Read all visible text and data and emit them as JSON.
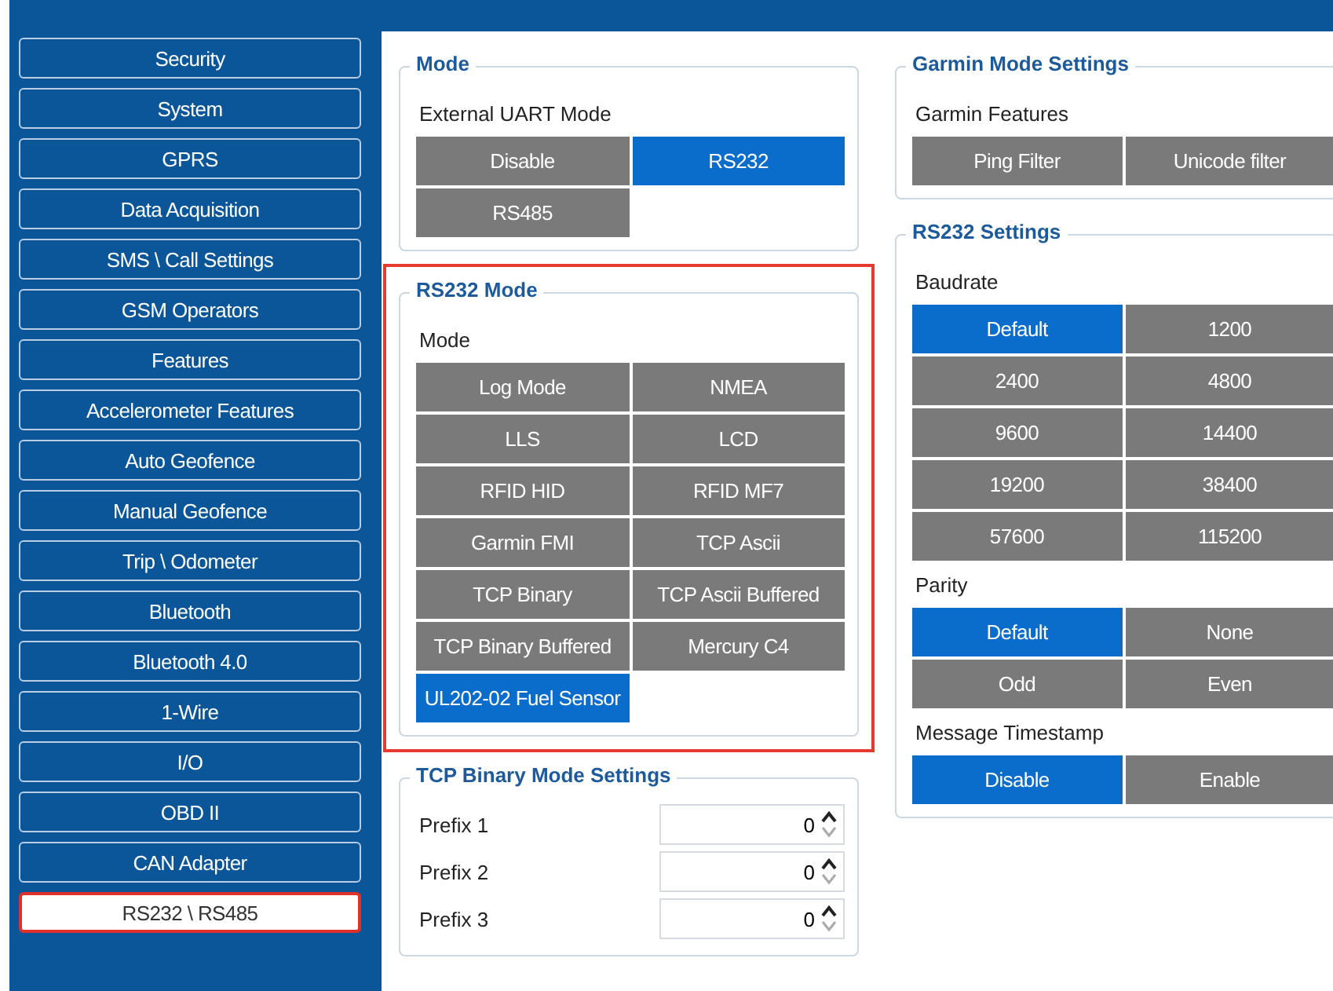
{
  "sidebar": {
    "items": [
      {
        "label": "Security",
        "selected": false
      },
      {
        "label": "System",
        "selected": false
      },
      {
        "label": "GPRS",
        "selected": false
      },
      {
        "label": "Data Acquisition",
        "selected": false
      },
      {
        "label": "SMS \\ Call Settings",
        "selected": false
      },
      {
        "label": "GSM Operators",
        "selected": false
      },
      {
        "label": "Features",
        "selected": false
      },
      {
        "label": "Accelerometer Features",
        "selected": false
      },
      {
        "label": "Auto Geofence",
        "selected": false
      },
      {
        "label": "Manual Geofence",
        "selected": false
      },
      {
        "label": "Trip \\ Odometer",
        "selected": false
      },
      {
        "label": "Bluetooth",
        "selected": false
      },
      {
        "label": "Bluetooth 4.0",
        "selected": false
      },
      {
        "label": "1-Wire",
        "selected": false
      },
      {
        "label": "I/O",
        "selected": false
      },
      {
        "label": "OBD II",
        "selected": false
      },
      {
        "label": "CAN Adapter",
        "selected": false
      },
      {
        "label": "RS232 \\ RS485",
        "selected": true
      }
    ]
  },
  "left_column": [
    {
      "title": "Mode",
      "kind": "options",
      "highlighted": false,
      "sections": [
        {
          "label": "External UART Mode",
          "options": [
            {
              "label": "Disable",
              "selected": false
            },
            {
              "label": "RS232",
              "selected": true
            },
            {
              "label": "RS485",
              "selected": false
            }
          ]
        }
      ]
    },
    {
      "title": "RS232 Mode",
      "kind": "options",
      "highlighted": true,
      "sections": [
        {
          "label": "Mode",
          "options": [
            {
              "label": "Log Mode",
              "selected": false
            },
            {
              "label": "NMEA",
              "selected": false
            },
            {
              "label": "LLS",
              "selected": false
            },
            {
              "label": "LCD",
              "selected": false
            },
            {
              "label": "RFID HID",
              "selected": false
            },
            {
              "label": "RFID MF7",
              "selected": false
            },
            {
              "label": "Garmin FMI",
              "selected": false
            },
            {
              "label": "TCP Ascii",
              "selected": false
            },
            {
              "label": "TCP Binary",
              "selected": false
            },
            {
              "label": "TCP Ascii Buffered",
              "selected": false
            },
            {
              "label": "TCP Binary Buffered",
              "selected": false
            },
            {
              "label": "Mercury C4",
              "selected": false
            },
            {
              "label": "UL202-02 Fuel Sensor",
              "selected": true
            }
          ]
        }
      ]
    },
    {
      "title": "TCP Binary Mode Settings",
      "kind": "fields",
      "highlighted": false,
      "fields": [
        {
          "label": "Prefix 1",
          "value": "0"
        },
        {
          "label": "Prefix 2",
          "value": "0"
        },
        {
          "label": "Prefix 3",
          "value": "0"
        }
      ]
    }
  ],
  "right_column": [
    {
      "title": "Garmin Mode Settings",
      "kind": "options",
      "highlighted": false,
      "sections": [
        {
          "label": "Garmin Features",
          "options": [
            {
              "label": "Ping Filter",
              "selected": false
            },
            {
              "label": "Unicode filter",
              "selected": false
            }
          ]
        }
      ]
    },
    {
      "title": "RS232 Settings",
      "kind": "options",
      "highlighted": false,
      "sections": [
        {
          "label": "Baudrate",
          "options": [
            {
              "label": "Default",
              "selected": true
            },
            {
              "label": "1200",
              "selected": false
            },
            {
              "label": "2400",
              "selected": false
            },
            {
              "label": "4800",
              "selected": false
            },
            {
              "label": "9600",
              "selected": false
            },
            {
              "label": "14400",
              "selected": false
            },
            {
              "label": "19200",
              "selected": false
            },
            {
              "label": "38400",
              "selected": false
            },
            {
              "label": "57600",
              "selected": false
            },
            {
              "label": "115200",
              "selected": false
            }
          ]
        },
        {
          "label": "Parity",
          "options": [
            {
              "label": "Default",
              "selected": true
            },
            {
              "label": "None",
              "selected": false
            },
            {
              "label": "Odd",
              "selected": false
            },
            {
              "label": "Even",
              "selected": false
            }
          ]
        },
        {
          "label": "Message Timestamp",
          "options": [
            {
              "label": "Disable",
              "selected": true
            },
            {
              "label": "Enable",
              "selected": false
            }
          ]
        }
      ]
    }
  ]
}
